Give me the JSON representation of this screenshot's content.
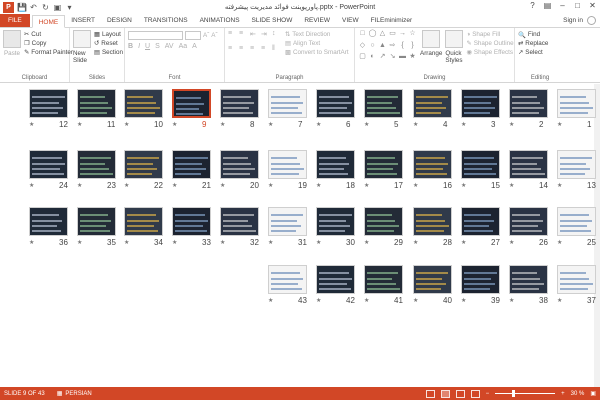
{
  "app": {
    "title": "پاورپوینت فوائد مدیریت پیشرفته.pptx - PowerPoint",
    "logo": "P",
    "sign_in": "Sign in"
  },
  "tabs": [
    "FILE",
    "HOME",
    "INSERT",
    "DESIGN",
    "TRANSITIONS",
    "ANIMATIONS",
    "SLIDE SHOW",
    "REVIEW",
    "VIEW",
    "FILEminimizer"
  ],
  "active_tab": "HOME",
  "ribbon": {
    "clipboard": {
      "paste": "Paste",
      "cut": "Cut",
      "copy": "Copy",
      "format_painter": "Format Painter",
      "label": "Clipboard"
    },
    "slides": {
      "new_slide": "New Slide",
      "layout": "Layout",
      "reset": "Reset",
      "section": "Section",
      "label": "Slides"
    },
    "font": {
      "label": "Font"
    },
    "paragraph": {
      "text_direction": "Text Direction",
      "align_text": "Align Text",
      "convert_smartart": "Convert to SmartArt",
      "label": "Paragraph"
    },
    "drawing": {
      "arrange": "Arrange",
      "quick_styles": "Quick Styles",
      "shape_fill": "Shape Fill",
      "shape_outline": "Shape Outline",
      "shape_effects": "Shape Effects",
      "label": "Drawing"
    },
    "editing": {
      "find": "Find",
      "replace": "Replace",
      "select": "Select",
      "label": "Editing"
    }
  },
  "slides": {
    "selected": 9,
    "rows": [
      [
        "12",
        "11",
        "10",
        "9",
        "8",
        "7",
        "6",
        "5",
        "4",
        "3",
        "2",
        "1"
      ],
      [
        "24",
        "23",
        "22",
        "21",
        "20",
        "19",
        "18",
        "17",
        "16",
        "15",
        "14",
        "13"
      ],
      [
        "36",
        "35",
        "34",
        "33",
        "32",
        "31",
        "30",
        "29",
        "28",
        "27",
        "26",
        "25"
      ],
      [
        "43",
        "42",
        "41",
        "40",
        "39",
        "38",
        "37"
      ]
    ]
  },
  "status": {
    "slide_info": "SLIDE 9 OF 43",
    "language": "PERSIAN",
    "zoom": "30 %",
    "zoom_fraction": 0.3
  },
  "colors": {
    "accent": "#d24726"
  }
}
